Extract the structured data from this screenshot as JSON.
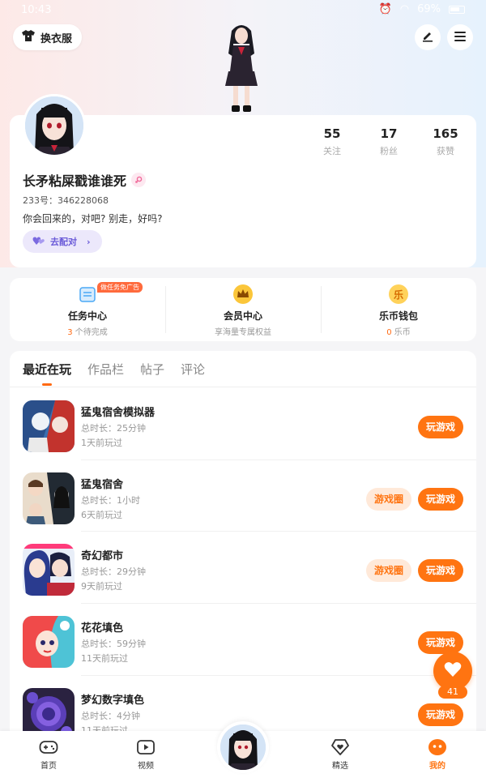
{
  "status_bar": {
    "time": "10:43",
    "battery": "69%"
  },
  "header": {
    "outfit_label": "换衣服",
    "edit_icon": "pencil-icon",
    "menu_icon": "hamburger-menu-icon"
  },
  "profile": {
    "stats": [
      {
        "value": "55",
        "label": "关注"
      },
      {
        "value": "17",
        "label": "粉丝"
      },
      {
        "value": "165",
        "label": "获赞"
      }
    ],
    "username": "长矛粘屎戳谁谁死",
    "uid": "233号：346228068",
    "bio": "你会回来的，对吧? 别走，好吗?",
    "pair_label": "去配对",
    "gender": "female"
  },
  "services": [
    {
      "title": "任务中心",
      "count": "3",
      "sub": "个待完成",
      "badge": "做任务免广告",
      "icon": "task-icon",
      "color": "#4aa8f5"
    },
    {
      "title": "会员中心",
      "count": "",
      "sub": "享海量专属权益",
      "badge": "",
      "icon": "crown-icon",
      "color": "#f5b400"
    },
    {
      "title": "乐币钱包",
      "count": "0",
      "sub": "乐币",
      "badge": "",
      "icon": "coin-icon",
      "color": "#ffb52e"
    }
  ],
  "tabs": [
    {
      "label": "最近在玩",
      "active": true
    },
    {
      "label": "作品栏",
      "active": false
    },
    {
      "label": "帖子",
      "active": false
    },
    {
      "label": "评论",
      "active": false
    }
  ],
  "games": [
    {
      "name": "猛鬼宿舍模拟器",
      "duration": "总时长：25分钟",
      "last_played": "1天前玩过",
      "play_label": "玩游戏",
      "circle_label": ""
    },
    {
      "name": "猛鬼宿舍",
      "duration": "总时长：1小时",
      "last_played": "6天前玩过",
      "play_label": "玩游戏",
      "circle_label": "游戏圈"
    },
    {
      "name": "奇幻都市",
      "duration": "总时长：29分钟",
      "last_played": "9天前玩过",
      "play_label": "玩游戏",
      "circle_label": "游戏圈"
    },
    {
      "name": "花花填色",
      "duration": "总时长：59分钟",
      "last_played": "11天前玩过",
      "play_label": "玩游戏",
      "circle_label": ""
    },
    {
      "name": "梦幻数字填色",
      "duration": "总时长：4分钟",
      "last_played": "11天前玩过",
      "play_label": "玩游戏",
      "circle_label": ""
    }
  ],
  "floating": {
    "count": "41",
    "icon": "heart-icon"
  },
  "bottom_nav": [
    {
      "label": "首页",
      "icon": "gamepad-icon",
      "active": false
    },
    {
      "label": "视频",
      "icon": "video-play-icon",
      "active": false
    },
    {
      "label": "精选",
      "icon": "heart-diamond-icon",
      "active": false
    },
    {
      "label": "我的",
      "icon": "face-icon",
      "active": true
    }
  ],
  "colors": {
    "accent": "#ff7411",
    "pair": "#6a5ad8"
  }
}
